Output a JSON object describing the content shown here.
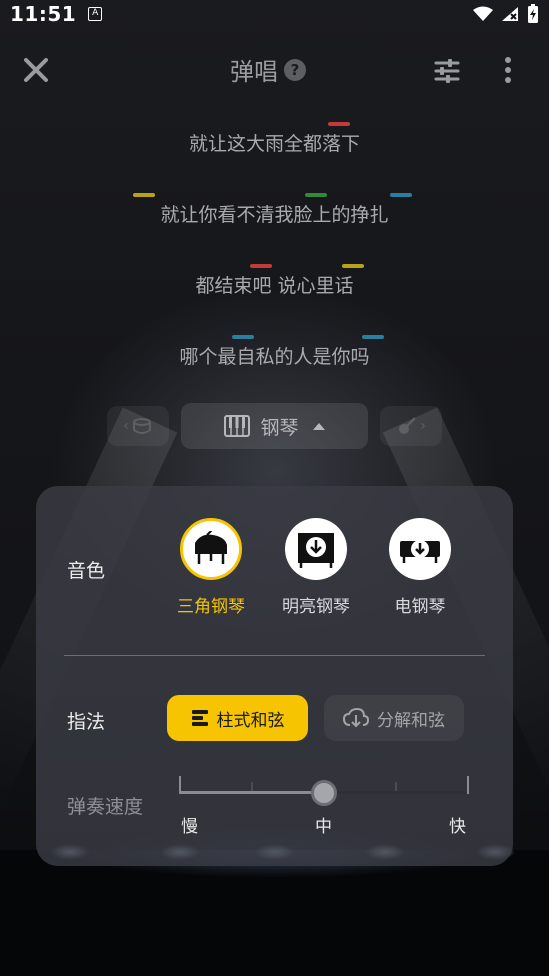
{
  "status_bar": {
    "time": "11:51",
    "notification_icon": "A"
  },
  "header": {
    "title": "弹唱",
    "help": "?"
  },
  "lyrics": [
    "就让这大雨全都落下",
    "就让你看不清我脸上的挣扎",
    "都结束吧 说心里话",
    "哪个最自私的人是你吗"
  ],
  "instrument": {
    "current": "钢琴"
  },
  "panel": {
    "tone_label": "音色",
    "tones": [
      {
        "name": "三角钢琴",
        "selected": true,
        "icon": "grand-piano-icon"
      },
      {
        "name": "明亮钢琴",
        "selected": false,
        "icon": "upright-piano-download-icon"
      },
      {
        "name": "电钢琴",
        "selected": false,
        "icon": "electric-piano-download-icon"
      }
    ],
    "fingering_label": "指法",
    "fingering_options": [
      {
        "label": "柱式和弦",
        "active": true,
        "icon": "chord-icon"
      },
      {
        "label": "分解和弦",
        "active": false,
        "icon": "cloud-download-icon"
      }
    ],
    "speed_label": "弹奏速度",
    "speed_marks": [
      "慢",
      "中",
      "快"
    ],
    "speed_value": "中"
  },
  "colors": {
    "accent": "#f6c400",
    "panel": "#3a3c44",
    "note_red": "#c23a3a",
    "note_yellow": "#b8a21c",
    "note_green": "#2f8a3a",
    "note_blue": "#2a7f9e"
  }
}
